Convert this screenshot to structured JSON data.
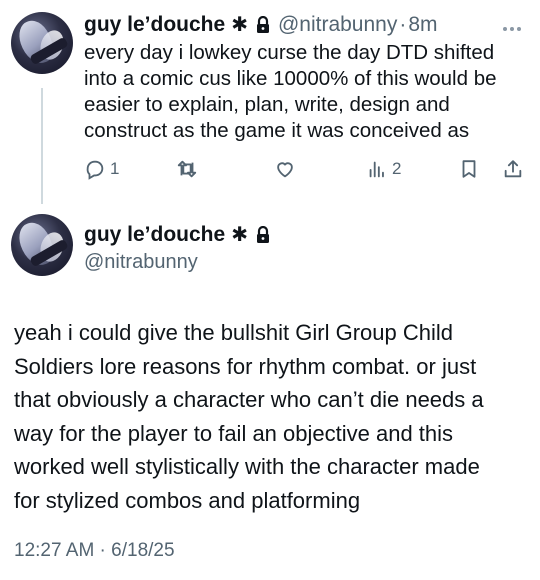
{
  "tweet1": {
    "display_name": "guy le’douche",
    "name_glyph": "✱",
    "handle": "@nitrabunny",
    "separator": "·",
    "time": "8m",
    "more_icon": "more-icon",
    "text_lines": [
      "every day i lowkey curse the day DTD shifted",
      "into a comic cus like 10000% of this would be",
      "easier to explain, plan, write, design and",
      "construct as the game it was conceived as"
    ],
    "actions": {
      "reply_count": "1",
      "repost_count": "",
      "like_count": "",
      "views_count": "2"
    }
  },
  "tweet2": {
    "display_name": "guy le’douche",
    "name_glyph": "✱",
    "handle": "@nitrabunny",
    "text_lines": [
      "yeah i could give the bullshit Girl Group Child",
      "Soldiers lore reasons for rhythm combat. or just",
      "that obviously a character who can’t die needs a",
      "way for the player to fail an objective and this",
      "worked well stylistically with the character made",
      "for stylized combos and platforming"
    ],
    "timestamp": "12:27 AM · 6/18/25"
  },
  "colors": {
    "text": "#0f1419",
    "muted": "#536471",
    "thread_line": "#cfd9de"
  }
}
